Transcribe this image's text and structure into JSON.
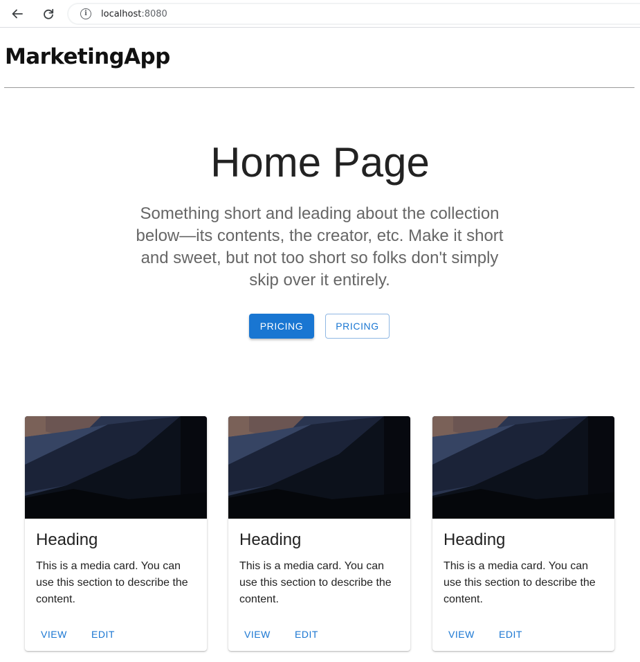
{
  "browser": {
    "url_host": "localhost",
    "url_port": ":8080"
  },
  "app": {
    "title": "MarketingApp"
  },
  "hero": {
    "title": "Home Page",
    "description": "Something short and leading about the collection below—its contents, the creator, etc. Make it short and sweet, but not too short so folks don't simply skip over it entirely.",
    "primary_button": "PRICING",
    "secondary_button": "PRICING"
  },
  "cards": [
    {
      "heading": "Heading",
      "text": "This is a media card. You can use this section to describe the content.",
      "view_label": "VIEW",
      "edit_label": "EDIT"
    },
    {
      "heading": "Heading",
      "text": "This is a media card. You can use this section to describe the content.",
      "view_label": "VIEW",
      "edit_label": "EDIT"
    },
    {
      "heading": "Heading",
      "text": "This is a media card. You can use this section to describe the content.",
      "view_label": "VIEW",
      "edit_label": "EDIT"
    }
  ],
  "colors": {
    "primary": "#1976d2",
    "text": "#222222",
    "muted_text": "#666666"
  },
  "icons": [
    "back-arrow-icon",
    "reload-icon",
    "info-icon"
  ]
}
